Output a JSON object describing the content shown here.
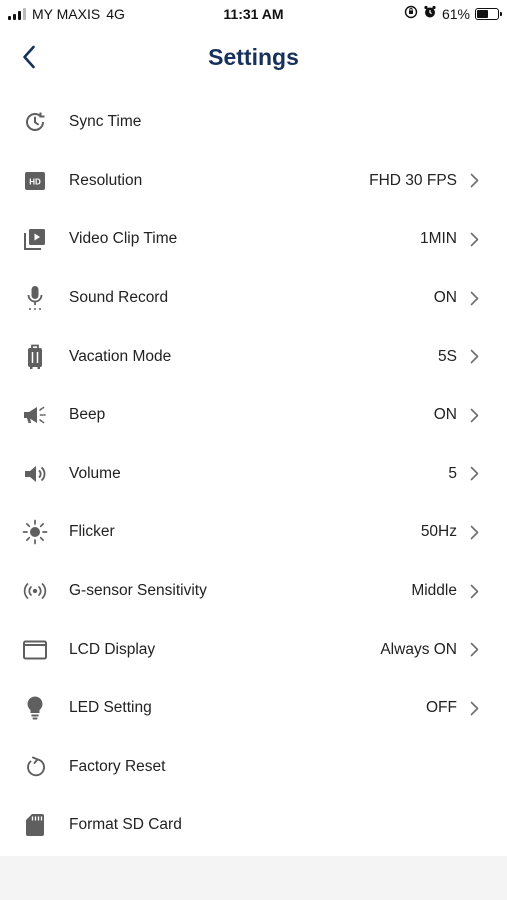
{
  "status_bar": {
    "carrier": "MY MAXIS",
    "network": "4G",
    "time": "11:31 AM",
    "battery_percent": "61%",
    "battery_level": 0.61
  },
  "header": {
    "title": "Settings"
  },
  "settings": [
    {
      "icon": "sync-time-icon",
      "label": "Sync Time",
      "value": ""
    },
    {
      "icon": "hd-icon",
      "label": "Resolution",
      "value": "FHD 30 FPS"
    },
    {
      "icon": "video-clip-icon",
      "label": "Video Clip Time",
      "value": "1MIN"
    },
    {
      "icon": "microphone-icon",
      "label": "Sound Record",
      "value": "ON"
    },
    {
      "icon": "luggage-icon",
      "label": "Vacation Mode",
      "value": "5S"
    },
    {
      "icon": "megaphone-icon",
      "label": "Beep",
      "value": "ON"
    },
    {
      "icon": "volume-icon",
      "label": "Volume",
      "value": "5"
    },
    {
      "icon": "brightness-icon",
      "label": "Flicker",
      "value": "50Hz"
    },
    {
      "icon": "sensor-icon",
      "label": "G-sensor Sensitivity",
      "value": "Middle"
    },
    {
      "icon": "display-icon",
      "label": "LCD Display",
      "value": "Always ON"
    },
    {
      "icon": "lightbulb-icon",
      "label": "LED Setting",
      "value": "OFF"
    },
    {
      "icon": "reset-icon",
      "label": "Factory Reset",
      "value": ""
    },
    {
      "icon": "sd-card-icon",
      "label": "Format SD Card",
      "value": ""
    }
  ],
  "colors": {
    "title": "#18315a",
    "icon": "#5f5f5f",
    "chevron": "#6e6e6e",
    "back": "#18315a",
    "footer": "#f4f4f4"
  }
}
